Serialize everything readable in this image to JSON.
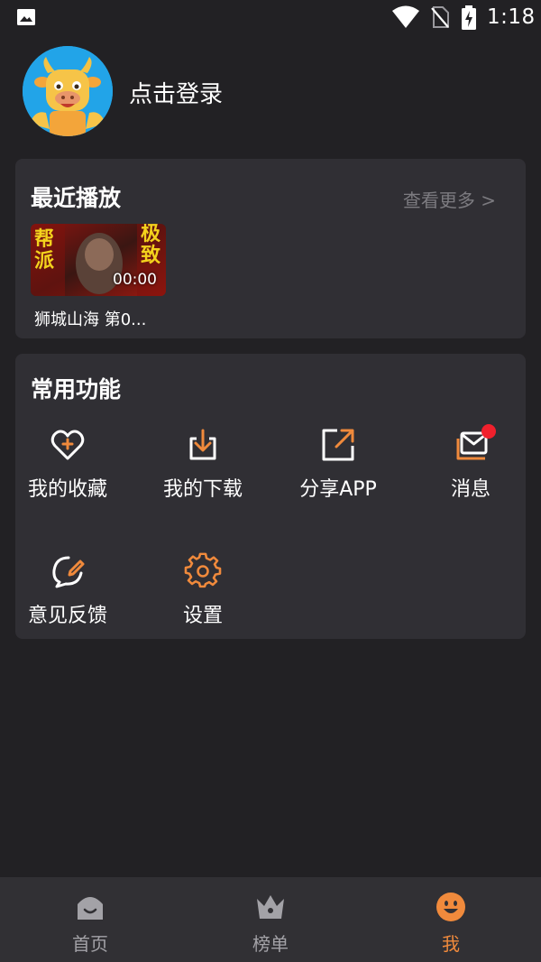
{
  "status_bar": {
    "time": "1:18",
    "icons": [
      "gallery-icon",
      "wifi-icon",
      "no-sim-icon",
      "battery-charging-icon"
    ]
  },
  "profile": {
    "login_label": "点击登录",
    "avatar_icon": "cow-mascot-avatar"
  },
  "recent": {
    "title": "最近播放",
    "more_label": "查看更多 >",
    "items": [
      {
        "title": "狮城山海 第0...",
        "duration": "00:00",
        "poster_text": [
          "帮派",
          "极致"
        ]
      }
    ]
  },
  "functions": {
    "title": "常用功能",
    "items": [
      {
        "label": "我的收藏",
        "icon": "heart-plus-icon"
      },
      {
        "label": "我的下载",
        "icon": "download-icon"
      },
      {
        "label": "分享APP",
        "icon": "share-icon"
      },
      {
        "label": "消息",
        "icon": "mail-icon",
        "has_badge": true
      },
      {
        "label": "意见反馈",
        "icon": "feedback-icon"
      },
      {
        "label": "设置",
        "icon": "gear-icon"
      }
    ]
  },
  "nav": {
    "items": [
      {
        "label": "首页",
        "icon": "home-icon",
        "active": false
      },
      {
        "label": "榜单",
        "icon": "crown-icon",
        "active": false
      },
      {
        "label": "我",
        "icon": "smiley-icon",
        "active": true
      }
    ]
  },
  "colors": {
    "background": "#222124",
    "card": "#302f34",
    "accent": "#f08a3c",
    "muted": "#7c7b80",
    "badge": "#f0202c"
  }
}
